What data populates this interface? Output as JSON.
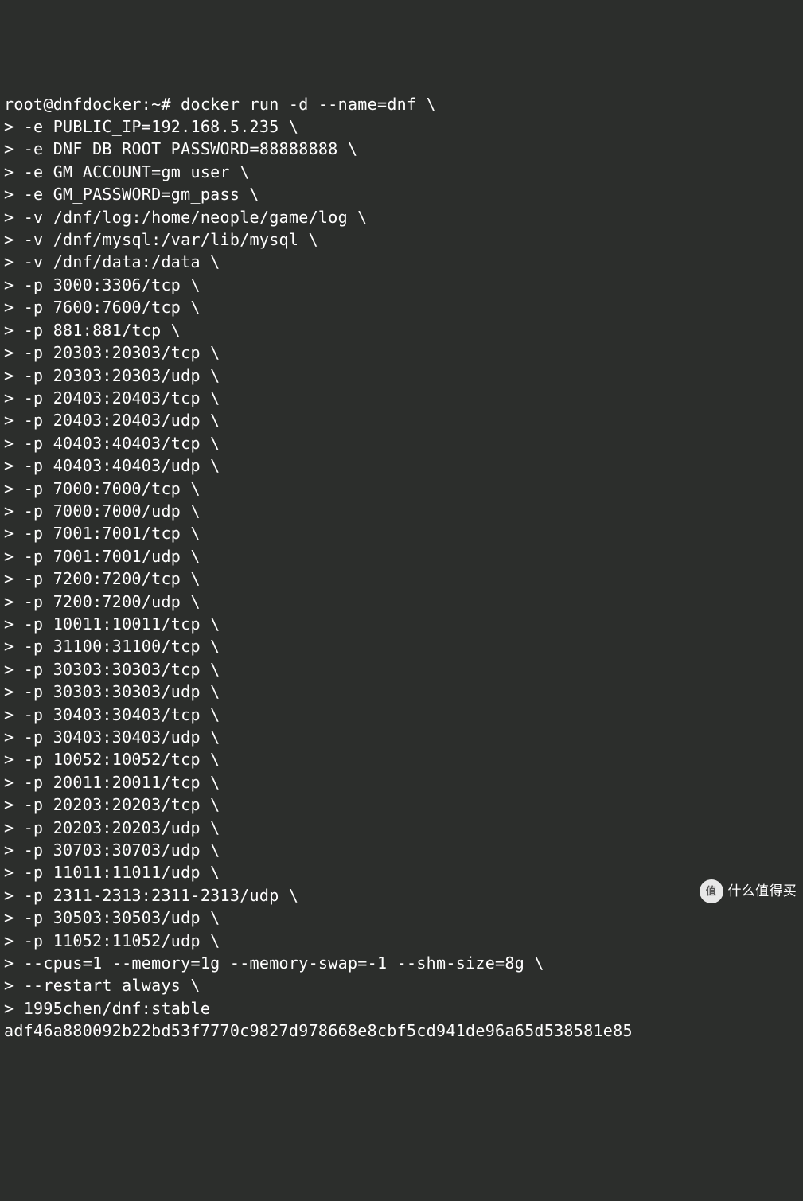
{
  "prompt": {
    "user_host": "root@dnfdocker",
    "cwd_sym": "~",
    "prompt_char": "#"
  },
  "command": {
    "base": "docker run -d --name=dnf",
    "env": [
      "-e PUBLIC_IP=192.168.5.235",
      "-e DNF_DB_ROOT_PASSWORD=88888888",
      "-e GM_ACCOUNT=gm_user",
      "-e GM_PASSWORD=gm_pass"
    ],
    "volumes": [
      "-v /dnf/log:/home/neople/game/log",
      "-v /dnf/mysql:/var/lib/mysql",
      "-v /dnf/data:/data"
    ],
    "ports": [
      "-p 3000:3306/tcp",
      "-p 7600:7600/tcp",
      "-p 881:881/tcp",
      "-p 20303:20303/tcp",
      "-p 20303:20303/udp",
      "-p 20403:20403/tcp",
      "-p 20403:20403/udp",
      "-p 40403:40403/tcp",
      "-p 40403:40403/udp",
      "-p 7000:7000/tcp",
      "-p 7000:7000/udp",
      "-p 7001:7001/tcp",
      "-p 7001:7001/udp",
      "-p 7200:7200/tcp",
      "-p 7200:7200/udp",
      "-p 10011:10011/tcp",
      "-p 31100:31100/tcp",
      "-p 30303:30303/tcp",
      "-p 30303:30303/udp",
      "-p 30403:30403/tcp",
      "-p 30403:30403/udp",
      "-p 10052:10052/tcp",
      "-p 20011:20011/tcp",
      "-p 20203:20203/tcp",
      "-p 20203:20203/udp",
      "-p 30703:30703/udp",
      "-p 11011:11011/udp",
      "-p 2311-2313:2311-2313/udp",
      "-p 30503:30503/udp",
      "-p 11052:11052/udp"
    ],
    "resources": "--cpus=1 --memory=1g --memory-swap=-1 --shm-size=8g",
    "restart": "--restart always",
    "image": "1995chen/dnf:stable"
  },
  "continuation_prompt": "> ",
  "backslash": " \\",
  "output": {
    "container_id": "adf46a880092b22bd53f7770c9827d978668e8cbf5cd941de96a65d538581e85"
  },
  "watermark": {
    "badge": "值",
    "text": "什么值得买"
  }
}
